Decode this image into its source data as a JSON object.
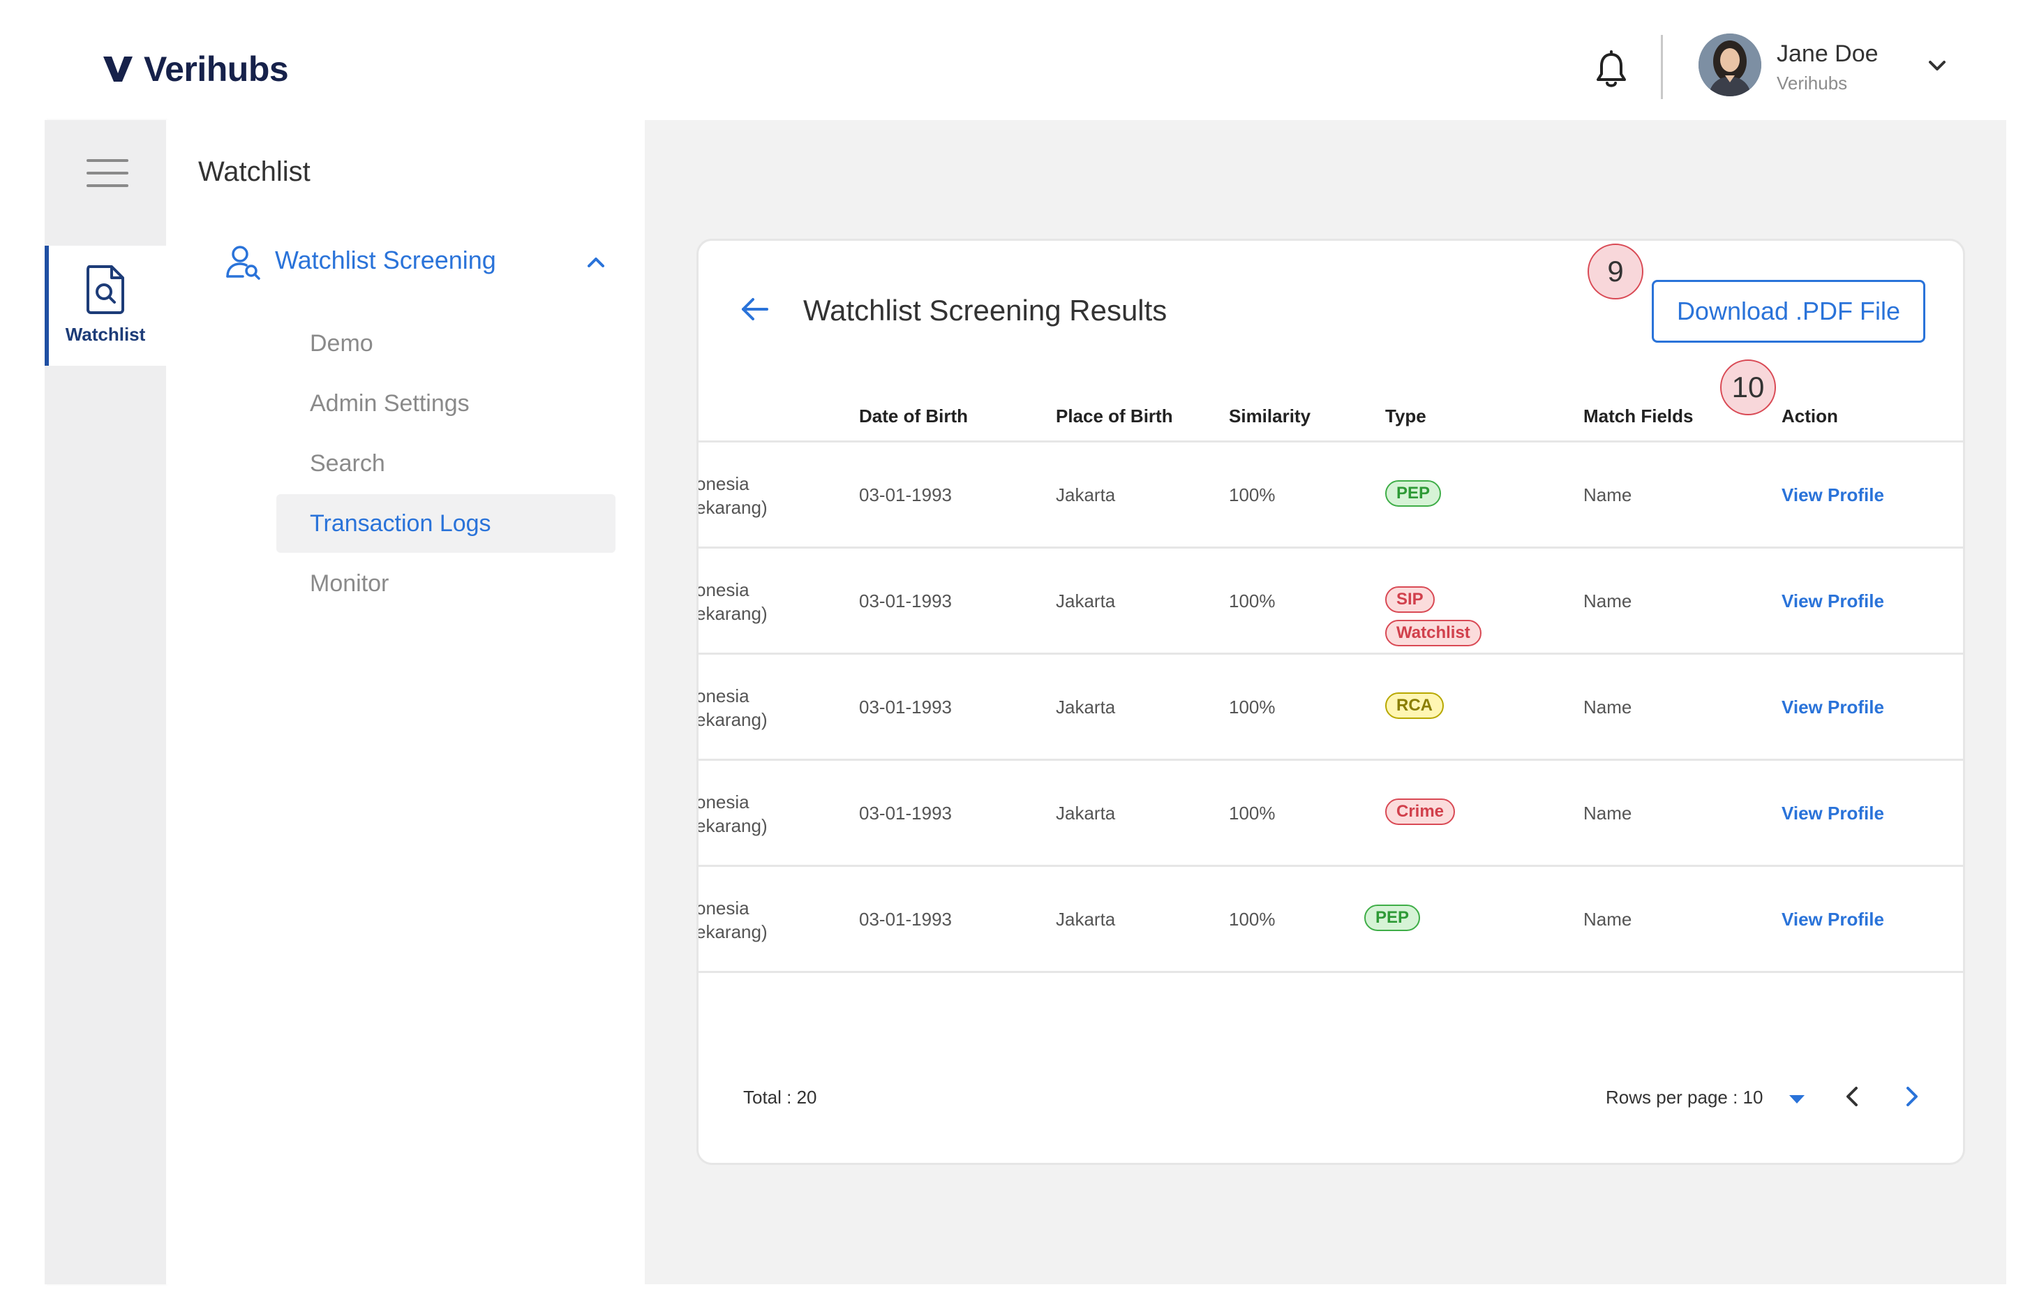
{
  "header": {
    "brand": "Verihubs",
    "user_name": "Jane Doe",
    "user_org": "Verihubs"
  },
  "rail": {
    "active_label": "Watchlist"
  },
  "subnav": {
    "title": "Watchlist",
    "group_label": "Watchlist Screening",
    "items": [
      {
        "label": "Demo"
      },
      {
        "label": "Admin Settings"
      },
      {
        "label": "Search"
      },
      {
        "label": "Transaction Logs"
      },
      {
        "label": "Monitor"
      }
    ]
  },
  "card": {
    "title": "Watchlist Screening Results",
    "download_label": "Download .PDF File",
    "badge_9": "9",
    "badge_10": "10",
    "columns": [
      "Date of Birth",
      "Place of Birth",
      "Similarity",
      "Type",
      "Match Fields",
      "Action"
    ],
    "rows": [
      {
        "name_1": "onesia",
        "name_2": "ekarang)",
        "dob": "03-01-1993",
        "pob": "Jakarta",
        "similarity": "100%",
        "types": [
          "PEP"
        ],
        "match": "Name",
        "action": "View Profile"
      },
      {
        "name_1": "onesia",
        "name_2": "ekarang)",
        "dob": "03-01-1993",
        "pob": "Jakarta",
        "similarity": "100%",
        "types": [
          "SIP",
          "Watchlist"
        ],
        "match": "Name",
        "action": "View Profile"
      },
      {
        "name_1": "onesia",
        "name_2": "ekarang)",
        "dob": "03-01-1993",
        "pob": "Jakarta",
        "similarity": "100%",
        "types": [
          "RCA"
        ],
        "match": "Name",
        "action": "View Profile"
      },
      {
        "name_1": "onesia",
        "name_2": "ekarang)",
        "dob": "03-01-1993",
        "pob": "Jakarta",
        "similarity": "100%",
        "types": [
          "Crime"
        ],
        "match": "Name",
        "action": "View Profile"
      },
      {
        "name_1": "onesia",
        "name_2": "ekarang)",
        "dob": "03-01-1993",
        "pob": "Jakarta",
        "similarity": "100%",
        "types": [
          "PEP"
        ],
        "match": "Name",
        "action": "View Profile"
      }
    ],
    "total": "Total : 20",
    "rows_per_page": "Rows per page : 10"
  },
  "colors": {
    "accent": "#2a73d9",
    "brand_navy": "#16214a",
    "tag_green": "#3fae48",
    "tag_red": "#d94a55",
    "tag_yellow": "#b8a800"
  }
}
